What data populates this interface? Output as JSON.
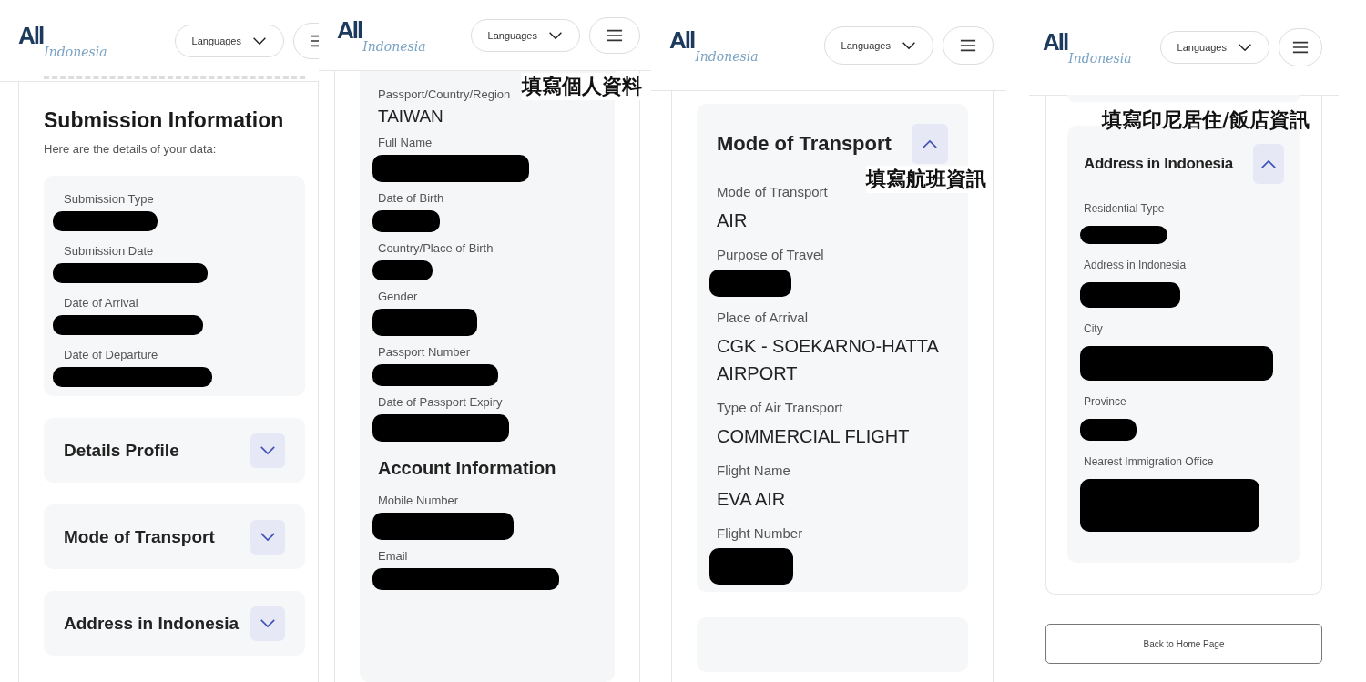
{
  "panels": [
    {
      "header": {
        "logo_bold": "All",
        "logo_script": "Indonesia",
        "languages": "Languages"
      },
      "blocks": [
        {
          "kind": "heading",
          "title": "Submission Information",
          "subtitle": "Here are the details of your data:"
        },
        {
          "kind": "card",
          "fields": [
            {
              "label": "Submission Type",
              "redacted": true
            },
            {
              "label": "Submission Date",
              "redacted": true
            },
            {
              "label": "Date of Arrival",
              "redacted": true
            },
            {
              "label": "Date of Departure",
              "redacted": true
            }
          ]
        },
        {
          "kind": "accordion",
          "title": "Details Profile",
          "expanded": false
        },
        {
          "kind": "accordion",
          "title": "Mode of Transport",
          "expanded": false
        },
        {
          "kind": "accordion",
          "title": "Address in Indonesia",
          "expanded": false
        }
      ]
    },
    {
      "header": {
        "logo_bold": "All",
        "logo_script": "Indonesia",
        "languages": "Languages"
      },
      "annotation": "填寫個人資料",
      "blocks": [
        {
          "kind": "card",
          "fields": [
            {
              "label": "Passport/Country/Region",
              "redacted": false,
              "value": "TAIWAN"
            },
            {
              "label": "Full Name",
              "redacted": true
            },
            {
              "label": "Date of Birth",
              "redacted": true
            },
            {
              "label": "Country/Place of Birth",
              "redacted": true
            },
            {
              "label": "Gender",
              "redacted": true
            },
            {
              "label": "Passport Number",
              "redacted": true
            },
            {
              "label": "Date of Passport Expiry",
              "redacted": true
            }
          ],
          "subheading": "Account Information",
          "more_fields": [
            {
              "label": "Mobile Number",
              "redacted": true
            },
            {
              "label": "Email",
              "redacted": true
            }
          ]
        }
      ]
    },
    {
      "header": {
        "logo_bold": "All",
        "logo_script": "Indonesia",
        "languages": "Languages"
      },
      "annotation": "填寫航班資訊",
      "blocks": [
        {
          "kind": "accordion",
          "title": "Mode of Transport",
          "expanded": true,
          "fields": [
            {
              "label": "Mode of Transport",
              "redacted": false,
              "value": "AIR"
            },
            {
              "label": "Purpose of Travel",
              "redacted": true
            },
            {
              "label": "Place of Arrival",
              "redacted": false,
              "value": "CGK - SOEKARNO-HATTA AIRPORT"
            },
            {
              "label": "Type of Air Transport",
              "redacted": false,
              "value": "COMMERCIAL FLIGHT"
            },
            {
              "label": "Flight Name",
              "redacted": false,
              "value": "EVA AIR"
            },
            {
              "label": "Flight Number",
              "redacted": true
            }
          ]
        },
        {
          "kind": "stub"
        }
      ]
    },
    {
      "header": {
        "logo_bold": "All",
        "logo_script": "Indonesia",
        "languages": "Languages"
      },
      "annotation": "填寫印尼居住/飯店資訊",
      "blocks": [
        {
          "kind": "stub"
        },
        {
          "kind": "accordion",
          "title": "Address in Indonesia",
          "expanded": true,
          "fields": [
            {
              "label": "Residential Type",
              "redacted": true
            },
            {
              "label": "Address in Indonesia",
              "redacted": true
            },
            {
              "label": "City",
              "redacted": true
            },
            {
              "label": "Province",
              "redacted": true
            },
            {
              "label": "Nearest Immigration Office",
              "redacted": true
            }
          ]
        }
      ],
      "button": "Back to Home Page"
    }
  ]
}
